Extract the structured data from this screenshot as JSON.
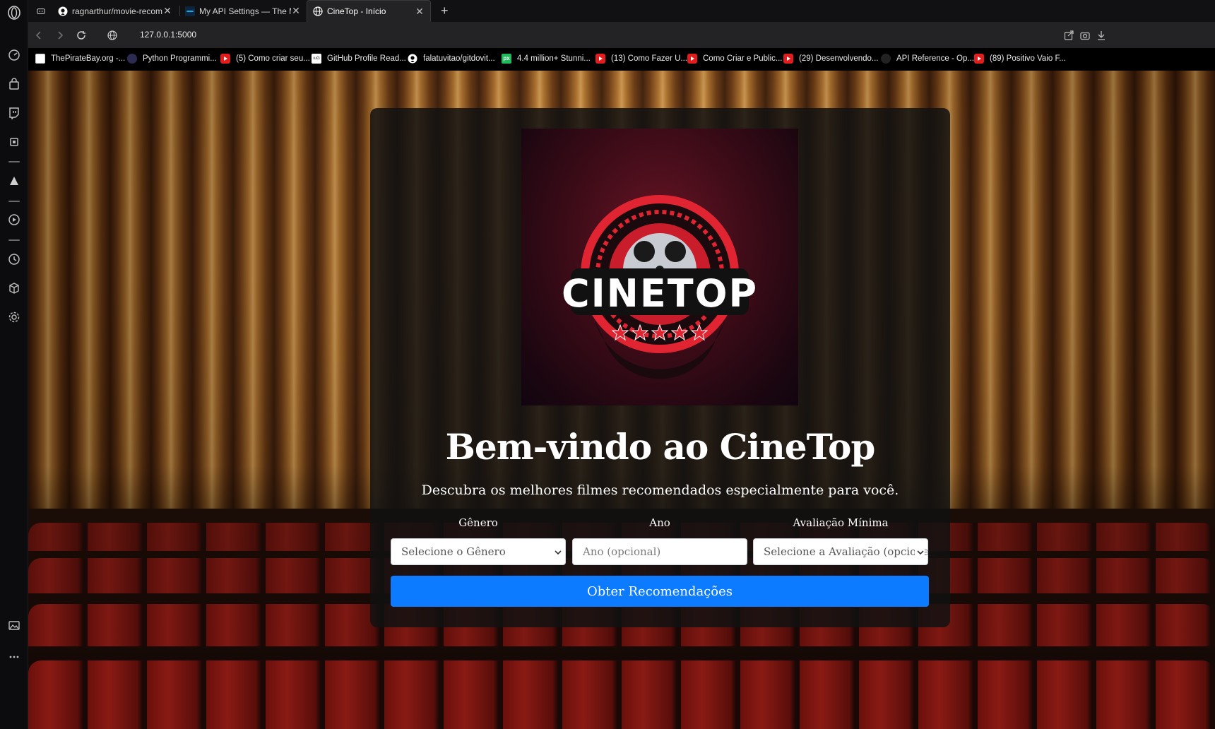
{
  "browser": {
    "tabs": [
      {
        "title": "ragnarthur/movie-recomm",
        "icon": "github-icon",
        "active": false
      },
      {
        "title": "My API Settings — The Mo",
        "icon": "tmdb-icon",
        "active": false
      },
      {
        "title": "CineTop - Início",
        "icon": "globe-icon",
        "active": true
      }
    ],
    "new_tab_label": "+",
    "address": {
      "url": "127.0.0.1:5000"
    },
    "bookmarks": [
      {
        "label": "ThePirateBay.org -...",
        "icon": "piratebay-icon"
      },
      {
        "label": "Python Programmi...",
        "icon": "python-icon"
      },
      {
        "label": "(5) Como criar seu...",
        "icon": "youtube-icon"
      },
      {
        "label": "GitHub Profile Read...",
        "icon": "readme-icon"
      },
      {
        "label": "falatuvitao/gitdovit...",
        "icon": "github-icon"
      },
      {
        "label": "4.4 million+ Stunni...",
        "icon": "pixabay-icon"
      },
      {
        "label": "(13) Como Fazer U...",
        "icon": "youtube-icon"
      },
      {
        "label": "Como Criar e Public...",
        "icon": "youtube-icon"
      },
      {
        "label": "(29) Desenvolvendo...",
        "icon": "youtube-icon"
      },
      {
        "label": "API Reference - Op...",
        "icon": "openai-icon"
      },
      {
        "label": "(89) Positivo Vaio F...",
        "icon": "youtube-icon"
      }
    ]
  },
  "page": {
    "logo_text": "CINETOP",
    "title": "Bem-vindo ao CineTop",
    "subtitle": "Descubra os melhores filmes recomendados especialmente para você.",
    "filters": {
      "genre": {
        "label": "Gênero",
        "value": "Selecione o Gênero"
      },
      "year": {
        "label": "Ano",
        "placeholder": "Ano (opcional)"
      },
      "rating": {
        "label": "Avaliação Mínima",
        "value": "Selecione a Avaliação (opcional)"
      }
    },
    "submit_label": "Obter Recomendações"
  },
  "colors": {
    "accent": "#0d7bff",
    "logo_red": "#e02431",
    "card_bg": "#111111"
  }
}
